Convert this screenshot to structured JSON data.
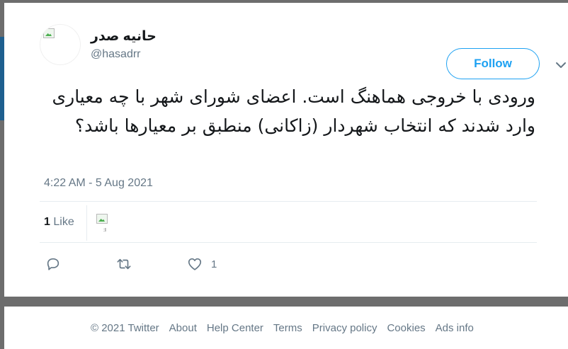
{
  "tweet": {
    "author_name": "حانیه صدر",
    "author_handle": "@hasadrr",
    "follow_label": "Follow",
    "text": "ورودی با خروجی هماهنگ است. اعضای شورای شهر با چه معیاری وارد شدند که انتخاب شهردار (زاکانی) منطبق بر معیارها باشد؟",
    "timestamp": "4:22 AM - 5 Aug 2021",
    "likes_count": "1",
    "likes_label": "Like",
    "liker_avatar_label": ":I",
    "action_like_count": "1"
  },
  "footer": {
    "copyright": "© 2021 Twitter",
    "links": [
      "About",
      "Help Center",
      "Terms",
      "Privacy policy",
      "Cookies",
      "Ads info"
    ]
  },
  "colors": {
    "accent": "#1da1f2",
    "secondary_text": "#657786",
    "primary_text": "#14171a"
  },
  "icons": [
    "reply-icon",
    "retweet-icon",
    "heart-icon",
    "chevron-down-icon"
  ]
}
